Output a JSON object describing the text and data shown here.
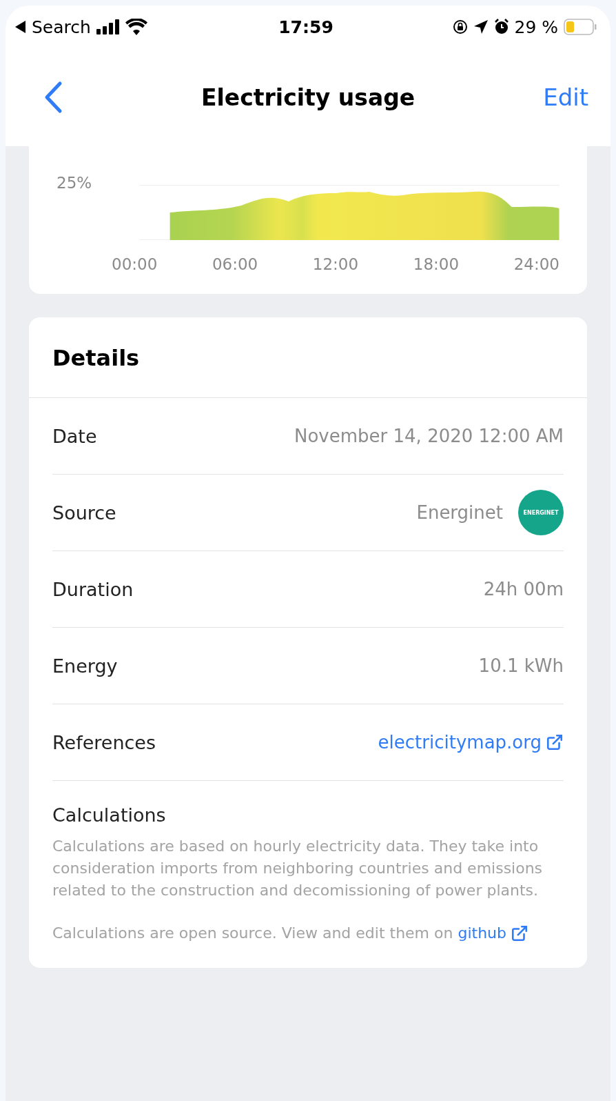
{
  "status_bar": {
    "back_label": "Search",
    "time": "17:59",
    "battery": "29 %"
  },
  "nav": {
    "title": "Electricity usage",
    "action": "Edit"
  },
  "chart_card": {
    "y_label": "25%",
    "x_labels": [
      "00:00",
      "06:00",
      "12:00",
      "18:00",
      "24:00"
    ]
  },
  "details": {
    "title": "Details",
    "rows": [
      {
        "kind": "text",
        "label": "Date",
        "value": "November 14, 2020 12:00 AM"
      },
      {
        "kind": "logo",
        "label": "Source",
        "value": "Energinet",
        "logo_text": "ENERGINET"
      },
      {
        "kind": "text",
        "label": "Duration",
        "value": "24h 00m"
      },
      {
        "kind": "text",
        "label": "Energy",
        "value": "10.1 kWh"
      },
      {
        "kind": "link",
        "label": "References",
        "value": "electricitymap.org"
      }
    ],
    "calculations": {
      "title": "Calculations",
      "paragraph": "Calculations are based on hourly electricity data. They take into consideration imports from neighboring countries and emissions related to the construction and decomissioning of power plants.",
      "open_source": "Calculations are open source. View and edit them on",
      "link": "github"
    }
  }
}
